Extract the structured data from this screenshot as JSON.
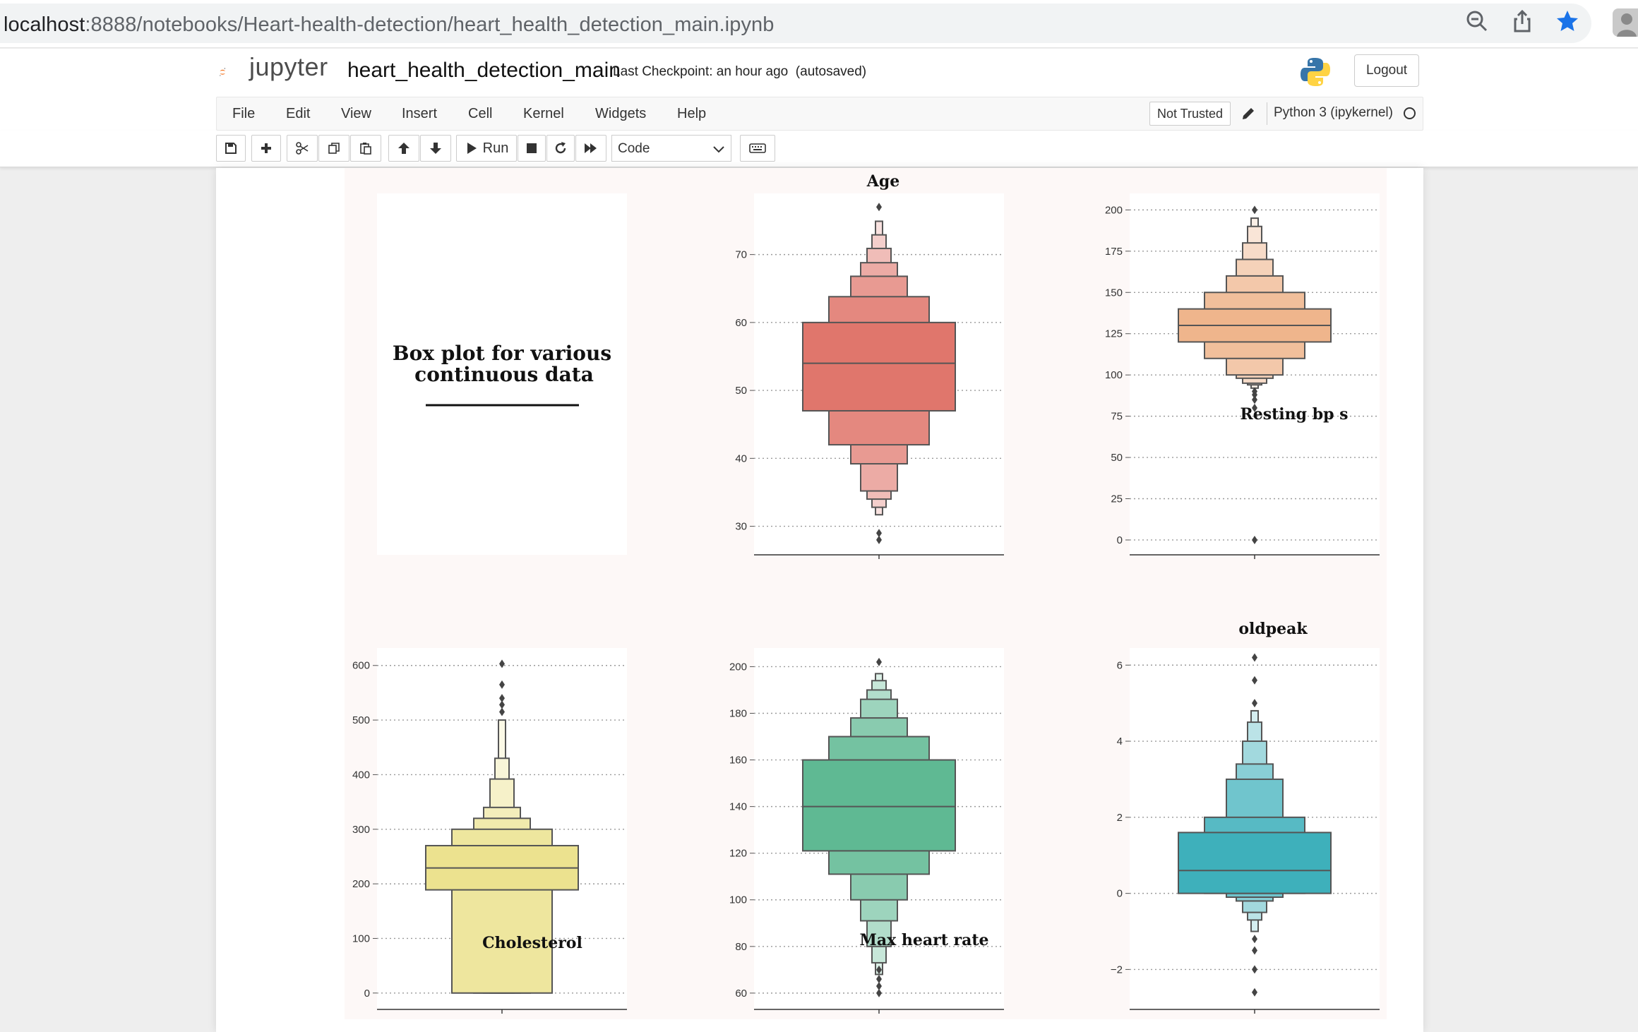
{
  "browser": {
    "url_host": "localhost",
    "url_path": ":8888/notebooks/Heart-health-detection/heart_health_detection_main.ipynb"
  },
  "header": {
    "logo_text": "jupyter",
    "notebook_name": "heart_health_detection_main",
    "checkpoint": "Last Checkpoint: an hour ago",
    "autosave": "(autosaved)",
    "logout_label": "Logout"
  },
  "menu": {
    "items": [
      "File",
      "Edit",
      "View",
      "Insert",
      "Cell",
      "Kernel",
      "Widgets",
      "Help"
    ],
    "trusted": "Not Trusted",
    "kernel": "Python 3 (ipykernel)"
  },
  "toolbar": {
    "run_label": "Run",
    "cell_type": "Code"
  },
  "figure": {
    "intro_text_line1": "Box plot for various",
    "intro_text_line2": "continuous data"
  },
  "chart_data": [
    {
      "type": "boxen",
      "title": "Age",
      "color": "#e0766c",
      "yticks": [
        30,
        40,
        50,
        60,
        70
      ],
      "ylim": [
        25.8,
        79
      ],
      "median": 54,
      "boxes": [
        [
          47,
          60
        ],
        [
          42,
          63.8
        ],
        [
          39.2,
          66.8
        ],
        [
          35.2,
          68.8
        ],
        [
          34,
          70.9
        ],
        [
          32.8,
          72.9
        ],
        [
          31.7,
          74.9
        ]
      ],
      "outliers": [
        29,
        28,
        77
      ]
    },
    {
      "type": "boxen",
      "title": "Resting bp s",
      "color": "#efb58c",
      "yticks": [
        0,
        25,
        50,
        75,
        100,
        125,
        150,
        175,
        200
      ],
      "ylim": [
        -9,
        210
      ],
      "median": 130,
      "boxes": [
        [
          120,
          140
        ],
        [
          110,
          150
        ],
        [
          100,
          160
        ],
        [
          98,
          170
        ],
        [
          95,
          180
        ],
        [
          94,
          190
        ],
        [
          92,
          195
        ]
      ],
      "outliers": [
        0,
        80,
        85,
        88,
        90,
        200
      ]
    },
    {
      "type": "boxen",
      "title": "Cholesterol",
      "color": "#ece28f",
      "yticks": [
        0,
        100,
        200,
        300,
        400,
        500,
        600
      ],
      "ylim": [
        -30,
        632
      ],
      "median": 229,
      "boxes": [
        [
          189,
          270
        ],
        [
          0,
          300
        ],
        [
          0,
          320
        ],
        [
          0,
          340
        ],
        [
          0,
          392
        ],
        [
          0,
          430
        ],
        [
          0,
          500
        ]
      ],
      "outliers": [
        515,
        528,
        540,
        565,
        603
      ]
    },
    {
      "type": "boxen",
      "title": "Max heart rate",
      "color": "#5fb993",
      "yticks": [
        60,
        80,
        100,
        120,
        140,
        160,
        180,
        200
      ],
      "ylim": [
        53,
        208
      ],
      "median": 140,
      "boxes": [
        [
          121,
          160
        ],
        [
          111,
          170
        ],
        [
          100,
          178
        ],
        [
          91,
          186
        ],
        [
          80,
          190
        ],
        [
          73,
          194
        ],
        [
          68,
          197
        ]
      ],
      "outliers": [
        60,
        63,
        66,
        70,
        202
      ]
    },
    {
      "type": "boxen",
      "title": "oldpeak",
      "color": "#3eb0bb",
      "yticks": [
        -2,
        0,
        2,
        4,
        6
      ],
      "ylim": [
        -3.05,
        6.45
      ],
      "median": 0.6,
      "boxes": [
        [
          0,
          1.6
        ],
        [
          0,
          2
        ],
        [
          -0.1,
          3
        ],
        [
          -0.2,
          3.4
        ],
        [
          -0.5,
          4
        ],
        [
          -0.7,
          4.5
        ],
        [
          -1.0,
          4.8
        ]
      ],
      "outliers": [
        -2.6,
        -2.0,
        -1.5,
        -1.2,
        5,
        5.6,
        6.2
      ]
    }
  ]
}
